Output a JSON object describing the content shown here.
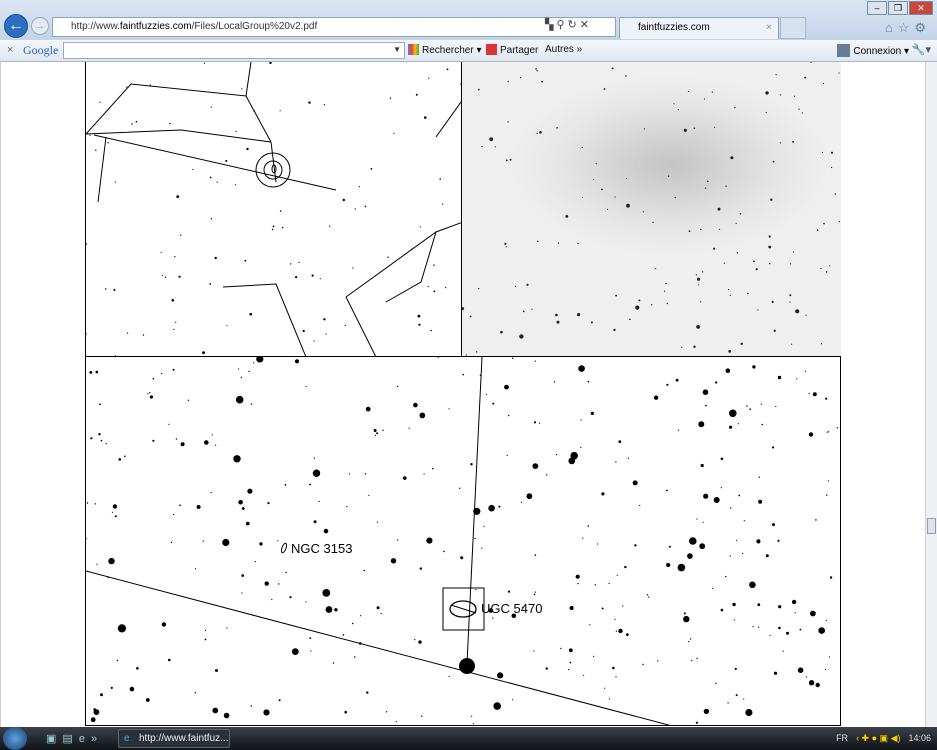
{
  "browser": {
    "url_prefix": "http://www.",
    "url_domain": "faintfuzzies.com",
    "url_path": "/Files/LocalGroup%20v2.pdf",
    "tab_title": "faintfuzzies.com",
    "google_label": "Google",
    "search_value": "",
    "rechercher": "Rechercher",
    "partager": "Partager",
    "autres": "Autres »",
    "connexion": "Connexion"
  },
  "chart": {
    "labels": [
      "NGC 3153",
      "UGC 5470"
    ]
  },
  "taskbar": {
    "task_title": "http://www.faintfuz...",
    "lang": "FR",
    "time": "14:06"
  }
}
